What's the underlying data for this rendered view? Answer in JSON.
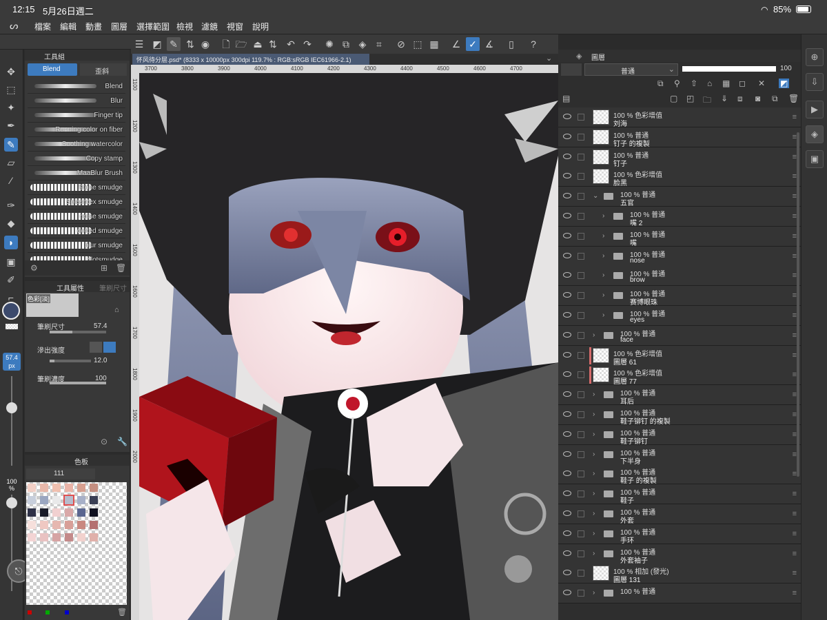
{
  "status": {
    "time": "12:15",
    "date": "5月26日週二",
    "battery": "85%"
  },
  "menu": [
    "檔案",
    "編輯",
    "動畫",
    "圖層",
    "選擇範圍",
    "檢視",
    "濾鏡",
    "視窗",
    "說明"
  ],
  "tool_panel": {
    "tab_title": "工具組",
    "sub_tool_selected": "Blend",
    "sub_tool_other": "歪斜",
    "brushes": [
      "Blend",
      "Blur",
      "Finger tip",
      "Running color on fiber",
      "Soothing watercolor",
      "Copy stamp",
      "MaaBlur Brush",
      "Stone smudge",
      "Splashtex smudge",
      "noise smudge",
      "dotted smudge",
      "blur smudge",
      "blotsmudge"
    ]
  },
  "properties": {
    "tab_title": "工具屬性",
    "tab_other": "筆刷尺寸",
    "preview_label": "色彩[淡]",
    "brush_size_label": "筆刷尺寸",
    "brush_size_value": "57.4",
    "bleed_label": "滲出強度",
    "bleed_value": "12.0",
    "density_label": "筆刷濃度",
    "density_value": "100",
    "size_badge": "57.4",
    "size_unit": "px",
    "opacity_badge": "100",
    "opacity_unit": "%"
  },
  "color_panel": {
    "tab_title": "色板",
    "set_value": "111"
  },
  "document": {
    "tab_label": "怀风待分层.psd* (8333 x 10000px 300dpi 119.7% : RGB:sRGB IEC61966-2.1)",
    "hruler": [
      "3700",
      "3800",
      "3900",
      "4000",
      "4100",
      "4200",
      "4300",
      "4400",
      "4500",
      "4600",
      "4700"
    ],
    "vruler": [
      "1100",
      "1200",
      "1300",
      "1400",
      "1500",
      "1600",
      "1700",
      "1800",
      "1900",
      "2000"
    ]
  },
  "layers": {
    "tab_title": "圖層",
    "blend_mode": "普通",
    "opacity": "100",
    "items": [
      {
        "mode": "100 % 色彩增值",
        "name": "刘海",
        "kind": "layer",
        "indent": 0
      },
      {
        "mode": "100 %  普通",
        "name": "钉子 的複製",
        "kind": "layer",
        "indent": 0
      },
      {
        "mode": "100 %  普通",
        "name": "钉子",
        "kind": "layer",
        "indent": 0
      },
      {
        "mode": "100 % 色彩增值",
        "name": "脸黑",
        "kind": "layer",
        "indent": 0
      },
      {
        "mode": "100 %  普通",
        "name": "五官",
        "kind": "folder-open",
        "indent": 0
      },
      {
        "mode": "100 %  普通",
        "name": "嘴 2",
        "kind": "folder",
        "indent": 1
      },
      {
        "mode": "100 %  普通",
        "name": "嘴",
        "kind": "folder",
        "indent": 1
      },
      {
        "mode": "100 %  普通",
        "name": "nose",
        "kind": "folder",
        "indent": 1
      },
      {
        "mode": "100 %  普通",
        "name": "brow",
        "kind": "folder",
        "indent": 1
      },
      {
        "mode": "100 %  普通",
        "name": "赛博眼珠",
        "kind": "folder",
        "indent": 1
      },
      {
        "mode": "100 %  普通",
        "name": "eyes",
        "kind": "folder",
        "indent": 1
      },
      {
        "mode": "100 %  普通",
        "name": "face",
        "kind": "folder",
        "indent": 0
      },
      {
        "mode": "100 % 色彩增值",
        "name": "圖層 61",
        "kind": "layer-red",
        "indent": 0
      },
      {
        "mode": "100 % 色彩增值",
        "name": "圖層 77",
        "kind": "layer-red",
        "indent": 0
      },
      {
        "mode": "100 %  普通",
        "name": "耳后",
        "kind": "folder",
        "indent": 0
      },
      {
        "mode": "100 %  普通",
        "name": "鞋子铆钉 的複製",
        "kind": "folder",
        "indent": 0
      },
      {
        "mode": "100 %  普通",
        "name": "鞋子铆钉",
        "kind": "folder",
        "indent": 0
      },
      {
        "mode": "100 %  普通",
        "name": "下半身",
        "kind": "folder",
        "indent": 0
      },
      {
        "mode": "100 %  普通",
        "name": "鞋子 的複製",
        "kind": "folder",
        "indent": 0
      },
      {
        "mode": "100 %  普通",
        "name": "鞋子",
        "kind": "folder",
        "indent": 0
      },
      {
        "mode": "100 %  普通",
        "name": "外套",
        "kind": "folder",
        "indent": 0
      },
      {
        "mode": "100 %  普通",
        "name": "手环",
        "kind": "folder",
        "indent": 0
      },
      {
        "mode": "100 %  普通",
        "name": "外套袖子",
        "kind": "folder",
        "indent": 0
      },
      {
        "mode": "100 % 相加 (發光)",
        "name": "圖層 131",
        "kind": "layer",
        "indent": 0
      },
      {
        "mode": "100 %  普通",
        "name": "",
        "kind": "folder",
        "indent": 0
      }
    ]
  }
}
